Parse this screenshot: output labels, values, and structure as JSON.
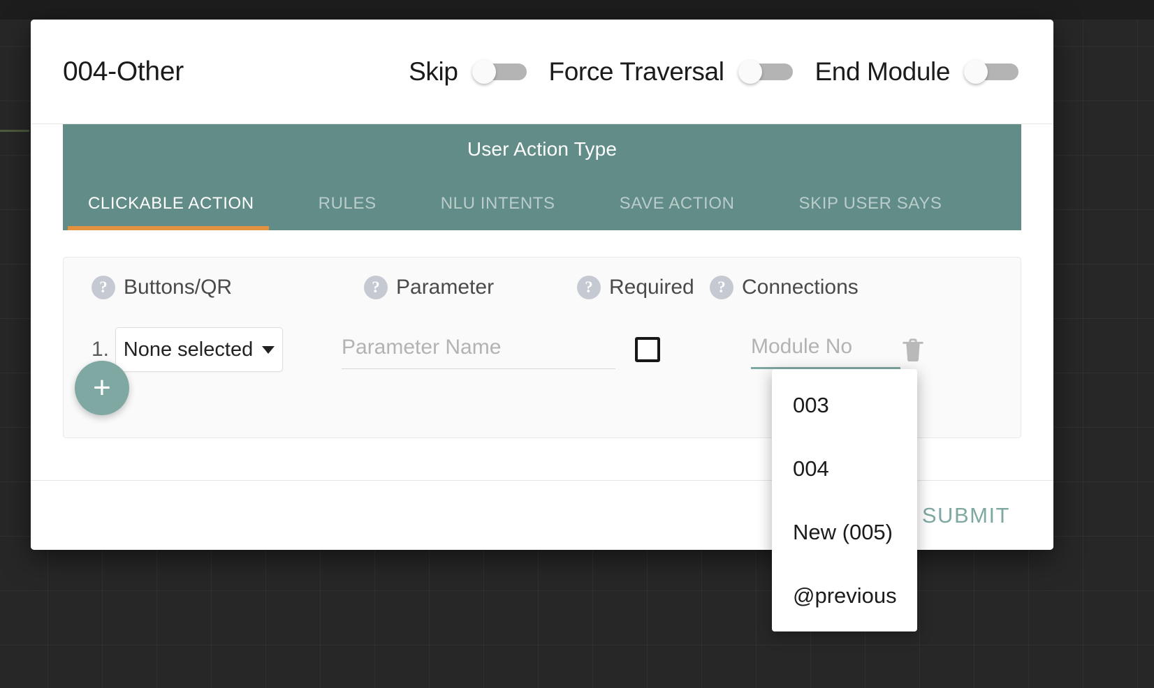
{
  "header": {
    "module_title": "004-Other",
    "toggles": [
      {
        "label": "Skip",
        "state": "off"
      },
      {
        "label": "Force Traversal",
        "state": "off"
      },
      {
        "label": "End Module",
        "state": "off"
      }
    ]
  },
  "tabs_section": {
    "title": "User Action Type",
    "active_index": 0,
    "accent_color": "#e2913f",
    "bar_color": "#618c87",
    "tabs": [
      {
        "label": "CLICKABLE ACTION"
      },
      {
        "label": "RULES"
      },
      {
        "label": "NLU INTENTS"
      },
      {
        "label": "SAVE ACTION"
      },
      {
        "label": "SKIP USER SAYS"
      }
    ]
  },
  "form": {
    "columns": [
      {
        "label": "Buttons/QR",
        "help_icon": "question-mark-icon"
      },
      {
        "label": "Parameter",
        "help_icon": "question-mark-icon"
      },
      {
        "label": "Required",
        "help_icon": "question-mark-icon"
      },
      {
        "label": "Connections",
        "help_icon": "question-mark-icon"
      }
    ],
    "rows": [
      {
        "index": "1.",
        "buttons_select_value": "None selected",
        "parameter_value": "",
        "parameter_placeholder": "Parameter Name",
        "required_checked": false,
        "connection_value": "",
        "connection_placeholder": "Module No",
        "delete_icon": "trash-icon"
      }
    ],
    "add_row_label": "+",
    "accent_color": "#7fa8a3"
  },
  "module_dropdown": {
    "open": true,
    "options": [
      "003",
      "004",
      "New (005)",
      "@previous"
    ]
  },
  "footer": {
    "submit_label": "SUBMIT"
  }
}
